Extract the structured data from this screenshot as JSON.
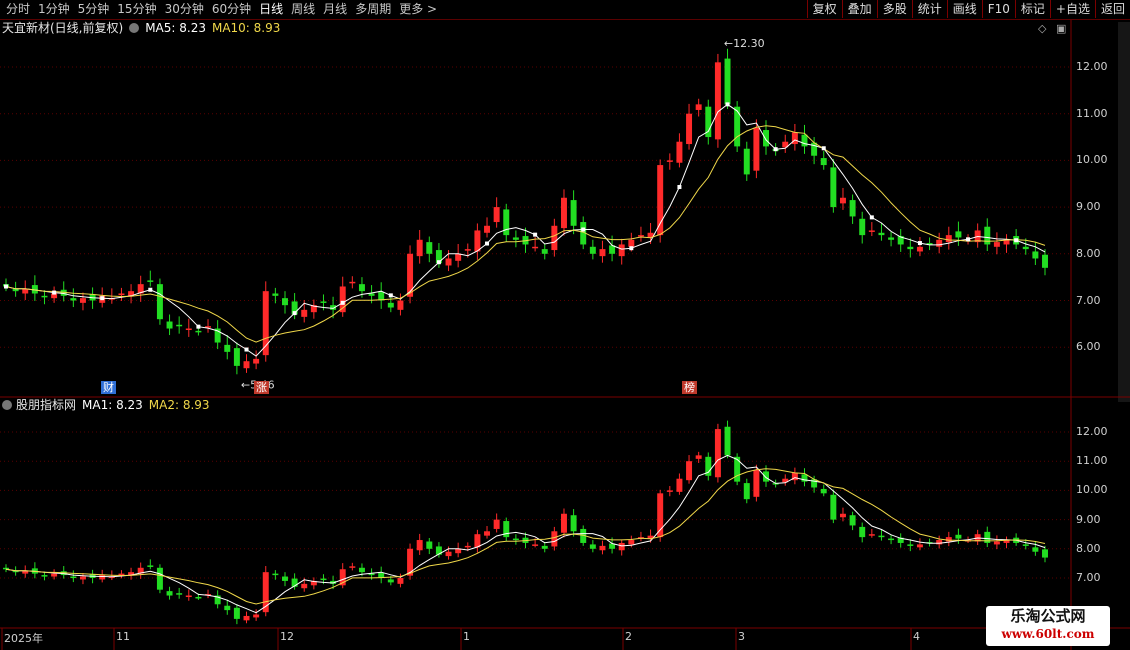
{
  "toolbar": {
    "periods": [
      "分时",
      "1分钟",
      "5分钟",
      "15分钟",
      "30分钟",
      "60分钟",
      "日线",
      "周线",
      "月线",
      "多周期",
      "更多 >"
    ],
    "active_period": "日线",
    "right_buttons": [
      "复权",
      "叠加",
      "多股",
      "统计",
      "画线",
      "F10",
      "标记",
      "+自选",
      "返回"
    ]
  },
  "main_panel": {
    "stock_name": "天宜新材(日线,前复权)",
    "ma5_label": "MA5: 8.23",
    "ma10_label": "MA10: 8.93",
    "y_ticks": [
      "12.00",
      "11.00",
      "10.00",
      "9.00",
      "8.00",
      "7.00",
      "6.00"
    ],
    "high_annotation": "12.30",
    "low_annotation": "5.46"
  },
  "sub_panel": {
    "indicator_name": "股朋指标网",
    "ma1_label": "MA1: 8.23",
    "ma2_label": "MA2: 8.93",
    "y_ticks": [
      "12.00",
      "11.00",
      "10.00",
      "9.00",
      "8.00",
      "7.00"
    ]
  },
  "markers": [
    {
      "text": "财",
      "color": "#2f6fd6"
    },
    {
      "text": "涨",
      "color": "#c0392b"
    },
    {
      "text": "榜",
      "color": "#c0392b"
    }
  ],
  "date_axis": [
    "2025年",
    "11",
    "12",
    "1",
    "2",
    "3",
    "4"
  ],
  "watermark": {
    "line1": "乐淘公式网",
    "line2": "www.60lt.com"
  },
  "colors": {
    "up": "#ff2a2a",
    "down": "#22dd22",
    "ma_short": "#ffffff",
    "ma_long": "#f0d84a",
    "grid": "#5a0000"
  },
  "chart_data": {
    "type": "candlestick",
    "ma_short_name": "MA5",
    "ma_long_name": "MA10",
    "ylim": [
      5.2,
      12.7
    ],
    "high": 12.3,
    "low": 5.46,
    "closes": [
      7.3,
      7.2,
      7.25,
      7.15,
      7.1,
      7.15,
      7.1,
      7.0,
      7.05,
      7.0,
      7.1,
      7.05,
      7.15,
      7.2,
      7.35,
      7.4,
      6.6,
      6.4,
      6.45,
      6.4,
      6.35,
      6.45,
      6.1,
      5.9,
      5.6,
      5.7,
      5.75,
      7.2,
      7.1,
      6.9,
      6.7,
      6.8,
      6.9,
      6.95,
      6.8,
      7.3,
      7.4,
      7.2,
      7.1,
      7.0,
      6.85,
      7.0,
      8.0,
      8.3,
      8.0,
      7.8,
      7.9,
      8.0,
      8.1,
      8.5,
      8.6,
      9.0,
      8.4,
      8.3,
      8.2,
      8.15,
      8.0,
      8.6,
      9.2,
      8.6,
      8.2,
      8.0,
      8.1,
      8.0,
      8.2,
      8.3,
      8.4,
      8.45,
      9.9,
      10.0,
      10.4,
      11.0,
      11.2,
      10.5,
      12.1,
      11.2,
      10.3,
      9.7,
      10.7,
      10.3,
      10.2,
      10.4,
      10.6,
      10.3,
      10.1,
      9.9,
      9.0,
      9.2,
      8.8,
      8.4,
      8.5,
      8.4,
      8.3,
      8.2,
      8.1,
      8.15,
      8.2,
      8.3,
      8.4,
      8.35,
      8.3,
      8.5,
      8.2,
      8.25,
      8.3,
      8.2,
      8.1,
      7.9,
      7.7
    ]
  }
}
